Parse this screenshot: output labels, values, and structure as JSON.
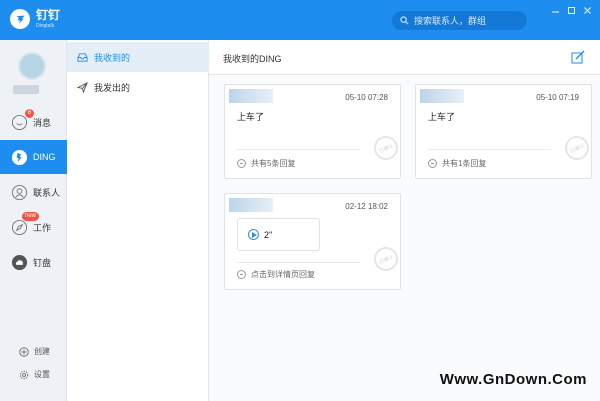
{
  "app": {
    "name": "钉钉",
    "subtitle": "Dingtalk",
    "search_placeholder": "搜索联系人，群组",
    "accent_color": "#1d8ef0"
  },
  "window_controls": [
    "minimize-icon",
    "maximize-icon",
    "close-icon"
  ],
  "nav": {
    "items": [
      {
        "label": "消息",
        "icon": "chat-icon",
        "badge": "6"
      },
      {
        "label": "DING",
        "icon": "ding-icon",
        "active": true
      },
      {
        "label": "联系人",
        "icon": "contacts-icon"
      },
      {
        "label": "工作",
        "icon": "compass-icon",
        "badge": "new"
      },
      {
        "label": "钉盘",
        "icon": "cloud-disk-icon"
      }
    ],
    "bottom": [
      {
        "label": "创建",
        "icon": "plus-icon"
      },
      {
        "label": "设置",
        "icon": "gear-icon"
      }
    ]
  },
  "subnav": {
    "items": [
      {
        "label": "我收到的",
        "icon": "inbox-icon",
        "active": true
      },
      {
        "label": "我发出的",
        "icon": "send-icon"
      }
    ]
  },
  "main": {
    "title": "我收到的DING",
    "cards": [
      {
        "time": "05-10 07:28",
        "content": "上车了",
        "footer": "共有5条回复",
        "stamp": "已确认"
      },
      {
        "time": "05-10 07:19",
        "content": "上车了",
        "footer": "共有1条回复",
        "stamp": "已确认"
      },
      {
        "time": "02-12 18:02",
        "voice_duration": "2\"",
        "footer": "点击到详情页回复",
        "stamp": "已确认"
      }
    ]
  },
  "watermark": "Www.GnDown.Com"
}
